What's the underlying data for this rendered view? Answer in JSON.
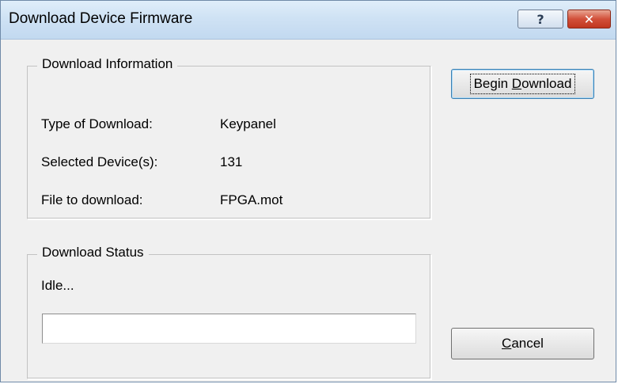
{
  "window": {
    "title": "Download Device Firmware",
    "help_glyph": "?",
    "close_glyph": "✕"
  },
  "info_group": {
    "legend": "Download Information",
    "rows": [
      {
        "label": "Type of Download:",
        "value": "Keypanel"
      },
      {
        "label": "Selected Device(s):",
        "value": "131"
      },
      {
        "label": "File to download:",
        "value": "FPGA.mot"
      }
    ]
  },
  "status_group": {
    "legend": "Download Status",
    "status_text": "Idle...",
    "progress": 0
  },
  "buttons": {
    "begin_pre": "Begin ",
    "begin_mnemonic": "D",
    "begin_post": "ownload",
    "cancel_mnemonic": "C",
    "cancel_post": "ancel"
  },
  "colors": {
    "titlebar": "#cfe2f4",
    "close_button": "#c8452d",
    "dialog_bg": "#f0f0f0",
    "progress_fill": "#3fb43f"
  }
}
